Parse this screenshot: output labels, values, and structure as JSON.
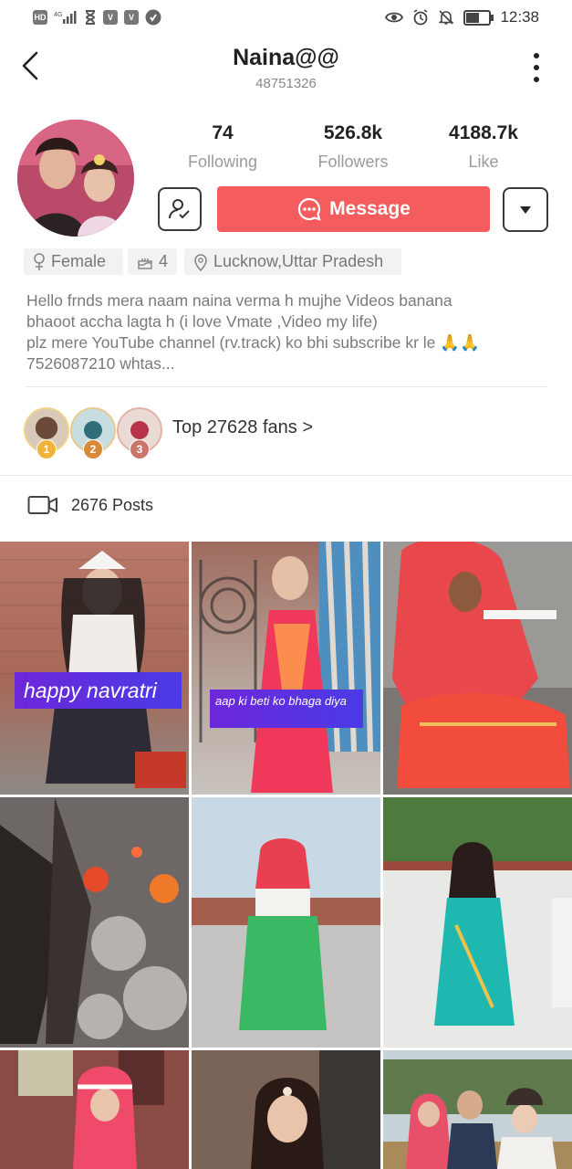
{
  "status_bar": {
    "left": [
      "HD",
      "4G",
      "signal",
      "hourglass",
      "v",
      "v",
      "shield"
    ],
    "time": "12:38",
    "battery_level": 0.6,
    "icons_right": [
      "eye-icon",
      "alarm-icon",
      "bell-off-icon",
      "battery-icon"
    ]
  },
  "header": {
    "title": "Naina@@",
    "user_id": "48751326"
  },
  "stats": {
    "following": {
      "value": "74",
      "label": "Following"
    },
    "followers": {
      "value": "526.8k",
      "label": "Followers"
    },
    "likes": {
      "value": "4188.7k",
      "label": "Like"
    }
  },
  "actions": {
    "message_label": "Message"
  },
  "tags": {
    "gender": "Female",
    "age": "4",
    "location": "Lucknow,Uttar Pradesh"
  },
  "bio": {
    "line1": "Hello frnds mera naam naina verma h mujhe Videos banana",
    "line2": "bhaoot accha lagta h (i love Vmate ,Video my life)",
    "line3": "plz mere YouTube channel (rv.track) ko bhi subscribe kr le 🙏🙏",
    "line4": "7526087210 whtas..."
  },
  "fans": {
    "ranks": [
      "1",
      "2",
      "3"
    ],
    "text": "Top 27628 fans >"
  },
  "posts": {
    "count_label": "2676 Posts",
    "captions": {
      "post1": "happy navratri",
      "post2": "aap ki beti ko bhaga diya"
    }
  },
  "colors": {
    "accent": "#f55c5d",
    "caption_purple": "#6d27d9",
    "rank1": "#f0b43a",
    "rank2": "#d88a3a",
    "rank3": "#c9766a"
  }
}
